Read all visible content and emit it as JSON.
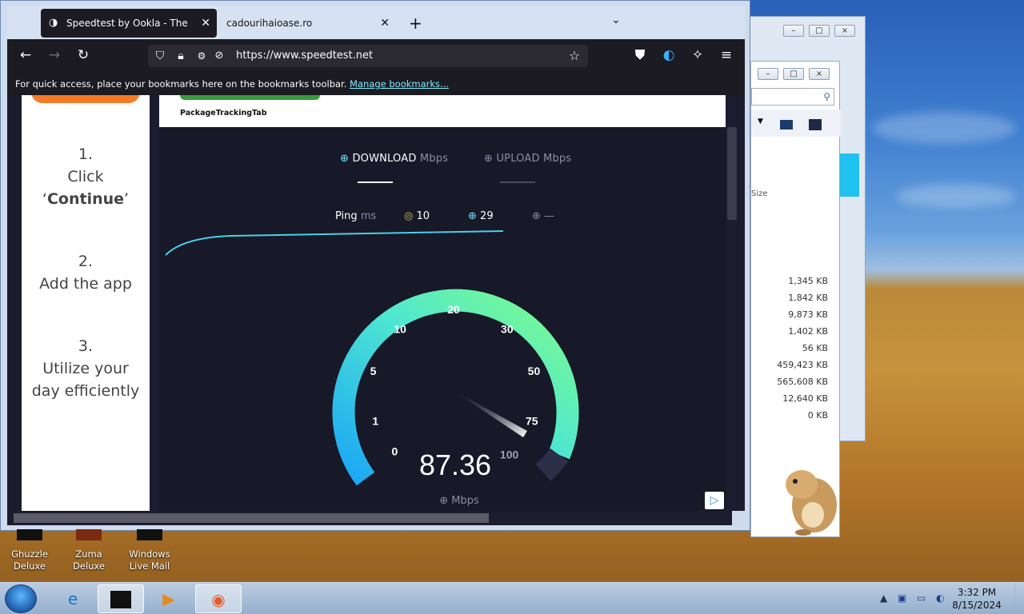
{
  "browser": {
    "tabs": [
      {
        "label": "Speedtest by Ookla - The Global",
        "active": true
      },
      {
        "label": "cadourihaioase.ro",
        "active": false
      }
    ],
    "new_tab_icon": "plus-icon",
    "list_tabs_icon": "chevron-down-icon",
    "url": "https://www.speedtest.net",
    "bookmarks_bar": {
      "message": "For quick access, place your bookmarks here on the bookmarks toolbar.",
      "link": "Manage bookmarks..."
    }
  },
  "ad_left": {
    "steps": [
      {
        "number": "1.",
        "line1": "Click",
        "line2_prefix": "‘",
        "line2_bold": "Continue",
        "line2_suffix": "’"
      },
      {
        "number": "2.",
        "line1": "Add the app"
      },
      {
        "number": "3.",
        "line1": "Utilize your",
        "line2": "day efficiently"
      }
    ]
  },
  "ad_top": {
    "label": "PackageTrackingTab"
  },
  "speedtest": {
    "download_label": "DOWNLOAD",
    "upload_label": "UPLOAD",
    "unit": "Mbps",
    "ping_label": "Ping",
    "ping_unit": "ms",
    "ping_value": "10",
    "download_ping": "29",
    "upload_ping": "—",
    "gauge_ticks": [
      "0",
      "1",
      "5",
      "10",
      "20",
      "30",
      "50",
      "75",
      "100"
    ],
    "current_value": "87.36",
    "current_unit": "Mbps",
    "accent_colors": {
      "start": "#2ab6ff",
      "end": "#7dfc8a"
    }
  },
  "explorer": {
    "column": "Size",
    "sizes": [
      "1,345 KB",
      "1,842 KB",
      "9,873 KB",
      "1,402 KB",
      "56 KB",
      "459,423 KB",
      "565,608 KB",
      "12,640 KB",
      "0 KB"
    ]
  },
  "desktop_icons": [
    {
      "line1": "Ghuzzle",
      "line2": "Deluxe"
    },
    {
      "line1": "Zuma Deluxe",
      "line2": ""
    },
    {
      "line1": "Windows",
      "line2": "Live Mail"
    }
  ],
  "taskbar": {
    "time": "3:32 PM",
    "date": "8/15/2024"
  }
}
